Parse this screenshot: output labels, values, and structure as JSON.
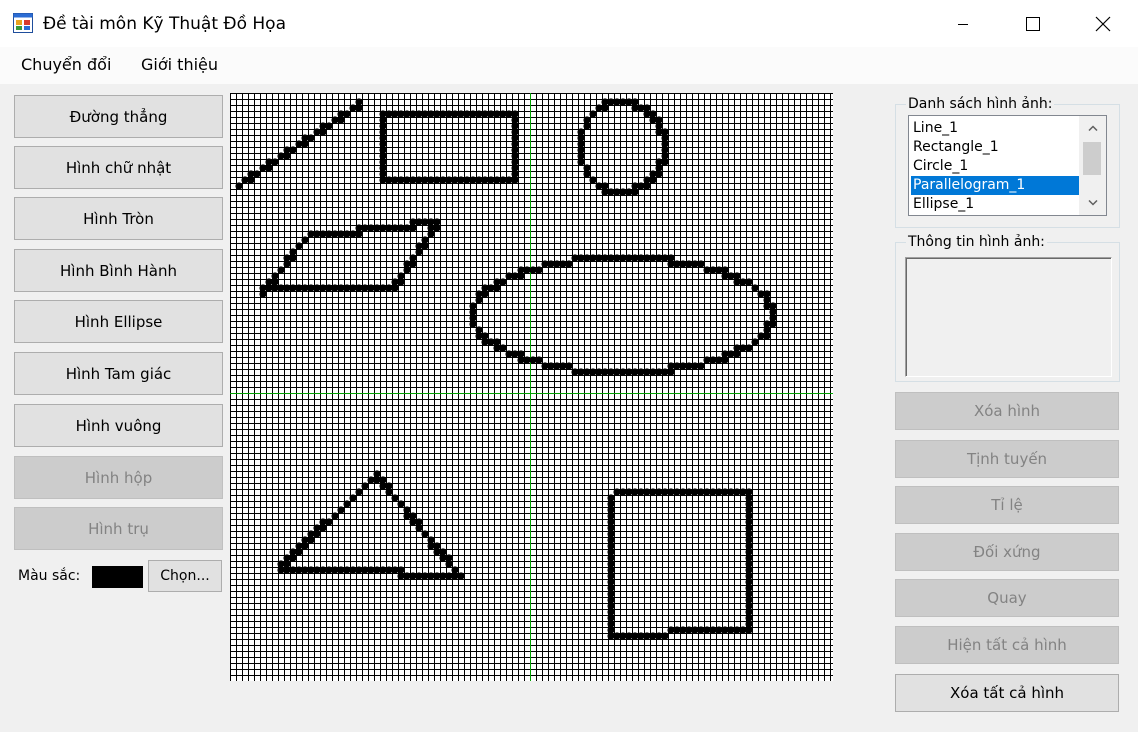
{
  "window": {
    "title": "Đề tài môn Kỹ Thuật Đồ Họa",
    "app_icon": "windows-form-icon",
    "controls": [
      "minimize-icon",
      "maximize-icon",
      "close-icon"
    ]
  },
  "menu": {
    "items": [
      {
        "label": "Chuyển đổi"
      },
      {
        "label": "Giới thiệu"
      }
    ]
  },
  "shape_buttons": [
    {
      "label": "Đường thẳng",
      "enabled": true
    },
    {
      "label": "Hình chữ nhật",
      "enabled": true
    },
    {
      "label": "Hình Tròn",
      "enabled": true
    },
    {
      "label": "Hình Bình Hành",
      "enabled": true
    },
    {
      "label": "Hình Ellipse",
      "enabled": true
    },
    {
      "label": "Hình Tam giác",
      "enabled": true
    },
    {
      "label": "Hình vuông",
      "enabled": true
    },
    {
      "label": "Hình hộp",
      "enabled": false
    },
    {
      "label": "Hình trụ",
      "enabled": false
    }
  ],
  "color": {
    "label": "Màu sắc:",
    "value": "#000000",
    "choose_label": "Chọn..."
  },
  "canvas": {
    "grid_color": "#000000",
    "axis_color": "#00a000",
    "pixel_color": "#000000"
  },
  "image_list": {
    "title": "Danh sách hình ảnh:",
    "items": [
      "Line_1",
      "Rectangle_1",
      "Circle_1",
      "Parallelogram_1",
      "Ellipse_1"
    ],
    "selected_index": 3
  },
  "image_info": {
    "title": "Thông tin hình ảnh:",
    "value": ""
  },
  "action_buttons": [
    {
      "label": "Xóa hình",
      "enabled": false
    },
    {
      "label": "Tịnh tuyến",
      "enabled": false
    },
    {
      "label": "Tỉ lệ",
      "enabled": false
    },
    {
      "label": "Đối xứng",
      "enabled": false
    },
    {
      "label": "Quay",
      "enabled": false
    },
    {
      "label": "Hiện tất cả hình",
      "enabled": false
    },
    {
      "label": "Xóa tất cả hình",
      "enabled": true
    }
  ]
}
